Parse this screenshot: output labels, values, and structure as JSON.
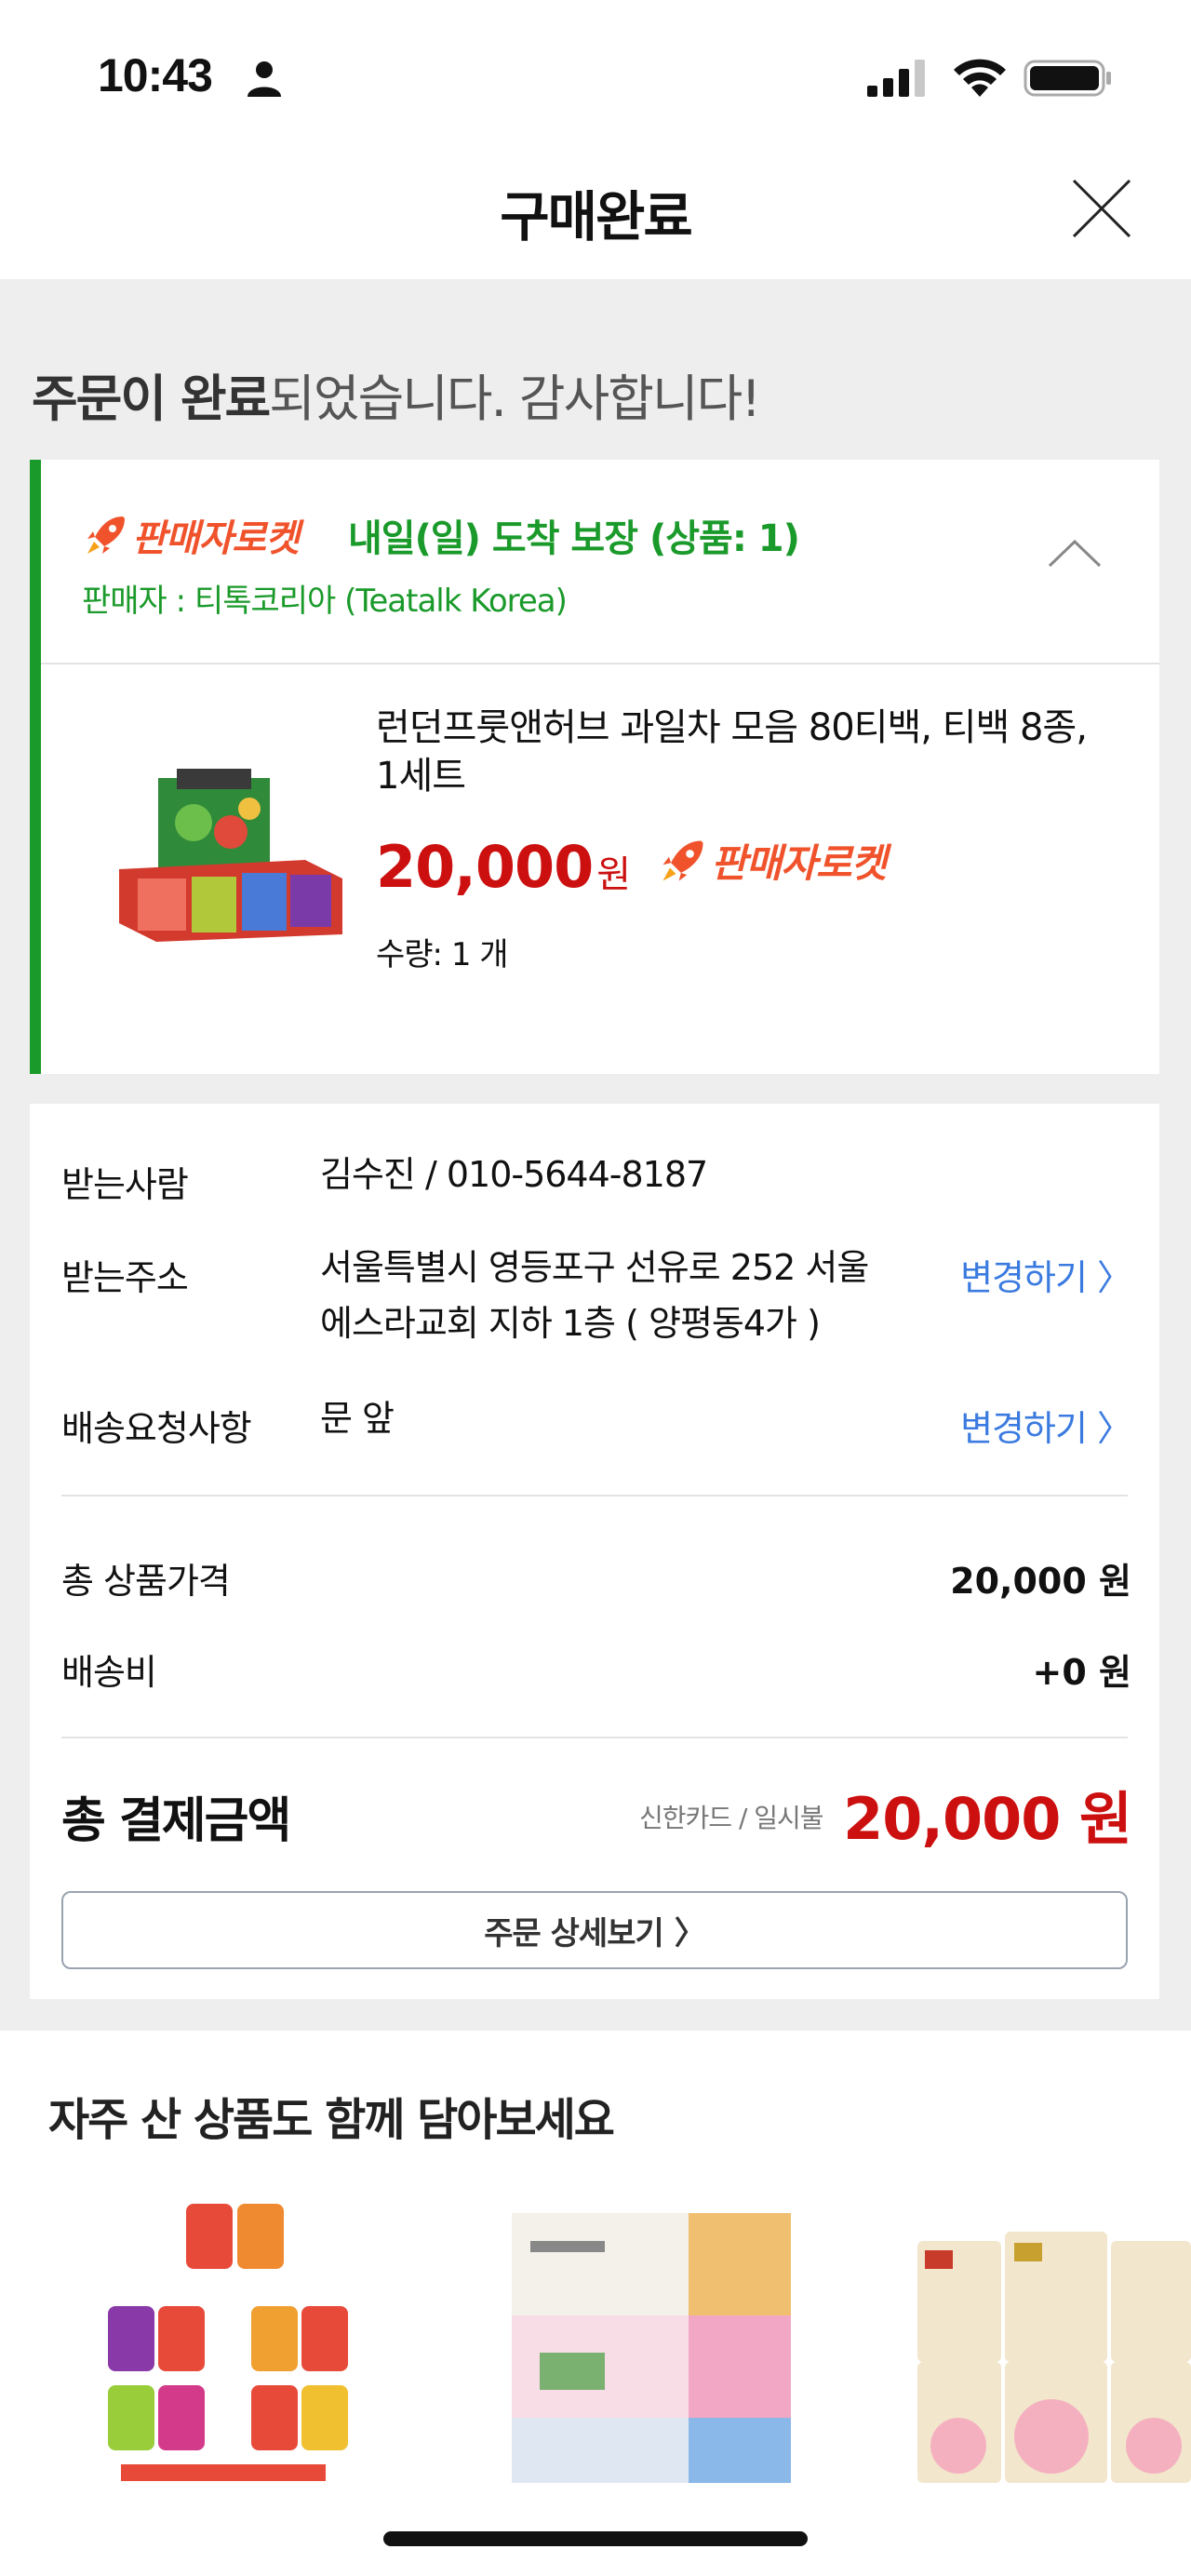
{
  "status_bar": {
    "time": "10:43"
  },
  "header": {
    "title": "구매완료"
  },
  "headline": {
    "bold": "주문이 완료",
    "rest": "되었습니다. 감사합니다!"
  },
  "order": {
    "rocket_badge": "판매자로켓",
    "arrival": "내일(일) 도착 보장 (상품: 1)",
    "seller": "판매자 : 티톡코리아 (Teatalk Korea)",
    "product_name": "런던프룻앤허브 과일차 모음 80티백, 티백 8종, 1세트",
    "price": "20,000",
    "price_unit": "원",
    "quantity": "수량: 1 개"
  },
  "info": {
    "recipient_label": "받는사람",
    "recipient_value": "김수진 / 010-5644-8187",
    "address_label": "받는주소",
    "address_line1": "서울특별시 영등포구 선유로 252 서울",
    "address_line2": "에스라교회 지하 1층 ( 양평동4가 )",
    "address_change": "변경하기 〉",
    "request_label": "배송요청사항",
    "request_value": "문 앞",
    "request_change": "변경하기 〉",
    "subtotal_label": "총 상품가격",
    "subtotal_value": "20,000 원",
    "shipping_label": "배송비",
    "shipping_value": "+0 원",
    "total_label": "총 결제금액",
    "pay_method": "신한카드 / 일시불",
    "total_value": "20,000 원",
    "detail_button": "주문 상세보기",
    "detail_chevron": "〉"
  },
  "recommend": {
    "title": "자주 산 상품도 함께 담아보세요"
  },
  "colors": {
    "accent_green": "#1a9a2a",
    "rocket_orange": "#f0532c",
    "price_red": "#cc1010",
    "link_blue": "#3b7be0"
  },
  "icons": [
    "person-icon",
    "signal-icon",
    "wifi-icon",
    "battery-icon",
    "close-icon",
    "rocket-icon",
    "chevron-up-icon"
  ]
}
